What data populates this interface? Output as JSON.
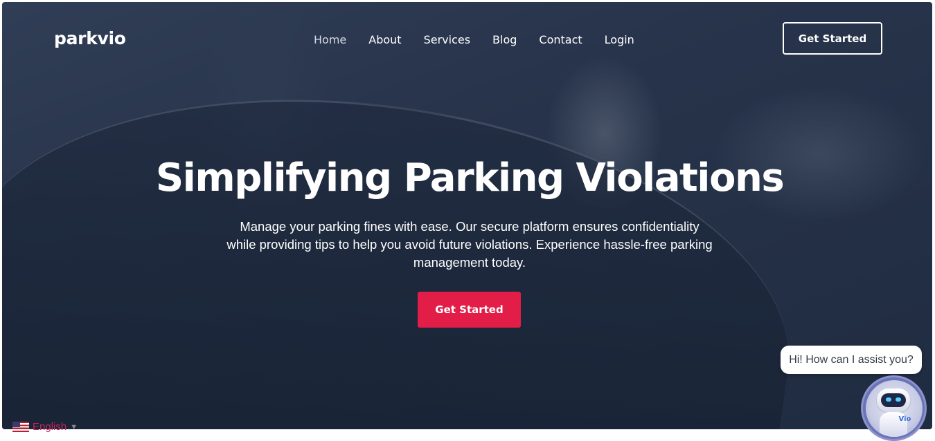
{
  "brand": {
    "logo_text": "parkvio"
  },
  "nav": {
    "items": [
      {
        "label": "Home",
        "active": true
      },
      {
        "label": "About"
      },
      {
        "label": "Services"
      },
      {
        "label": "Blog"
      },
      {
        "label": "Contact"
      },
      {
        "label": "Login"
      }
    ],
    "cta_label": "Get Started"
  },
  "hero": {
    "headline": "Simplifying Parking Violations",
    "subtitle": "Manage your parking fines with ease. Our secure platform ensures confidentiality while providing tips to help you avoid future violations. Experience hassle-free parking management today.",
    "cta_label": "Get Started",
    "cta_color": "#e11d48",
    "background_icon": "photo-parking-officer-writing-ticket"
  },
  "language": {
    "selected": "English",
    "flag_icon": "us-flag-icon"
  },
  "chat": {
    "greeting": "Hi! How can I assist you?",
    "bot_name": "Vio"
  }
}
